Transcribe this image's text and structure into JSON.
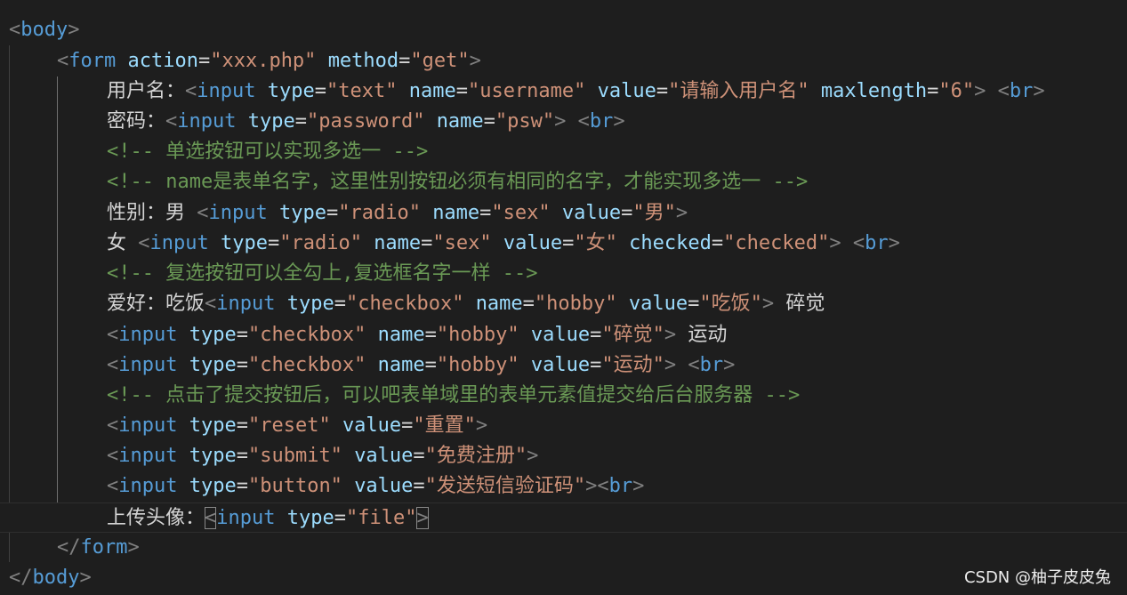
{
  "lines": [
    {
      "tokens": [
        [
          "tagp",
          "<"
        ],
        [
          "tag",
          "body"
        ],
        [
          "tagp",
          ">"
        ]
      ]
    },
    {
      "tokens": [
        [
          "tagp",
          "<"
        ],
        [
          "tag",
          "form"
        ],
        [
          "text",
          " "
        ],
        [
          "attr",
          "action"
        ],
        [
          "eq",
          "="
        ],
        [
          "str",
          "\"xxx.php\""
        ],
        [
          "text",
          " "
        ],
        [
          "attr",
          "method"
        ],
        [
          "eq",
          "="
        ],
        [
          "str",
          "\"get\""
        ],
        [
          "tagp",
          ">"
        ]
      ]
    },
    {
      "tokens": [
        [
          "text",
          "用户名："
        ],
        [
          "tagp",
          "<"
        ],
        [
          "tag",
          "input"
        ],
        [
          "text",
          " "
        ],
        [
          "attr",
          "type"
        ],
        [
          "eq",
          "="
        ],
        [
          "str",
          "\"text\""
        ],
        [
          "text",
          " "
        ],
        [
          "attr",
          "name"
        ],
        [
          "eq",
          "="
        ],
        [
          "str",
          "\"username\""
        ],
        [
          "text",
          " "
        ],
        [
          "attr",
          "value"
        ],
        [
          "eq",
          "="
        ],
        [
          "str",
          "\"请输入用户名\""
        ],
        [
          "text",
          " "
        ],
        [
          "attr",
          "maxlength"
        ],
        [
          "eq",
          "="
        ],
        [
          "str",
          "\"6\""
        ],
        [
          "tagp",
          ">"
        ],
        [
          "text",
          " "
        ],
        [
          "tagp",
          "<"
        ],
        [
          "tag",
          "br"
        ],
        [
          "tagp",
          ">"
        ]
      ]
    },
    {
      "tokens": [
        [
          "text",
          "密码："
        ],
        [
          "tagp",
          "<"
        ],
        [
          "tag",
          "input"
        ],
        [
          "text",
          " "
        ],
        [
          "attr",
          "type"
        ],
        [
          "eq",
          "="
        ],
        [
          "str",
          "\"password\""
        ],
        [
          "text",
          " "
        ],
        [
          "attr",
          "name"
        ],
        [
          "eq",
          "="
        ],
        [
          "str",
          "\"psw\""
        ],
        [
          "tagp",
          ">"
        ],
        [
          "text",
          " "
        ],
        [
          "tagp",
          "<"
        ],
        [
          "tag",
          "br"
        ],
        [
          "tagp",
          ">"
        ]
      ]
    },
    {
      "tokens": [
        [
          "com",
          "<!-- 单选按钮可以实现多选一 -->"
        ]
      ]
    },
    {
      "tokens": [
        [
          "com",
          "<!-- name是表单名字，这里性别按钮必须有相同的名字，才能实现多选一 -->"
        ]
      ]
    },
    {
      "tokens": [
        [
          "text",
          "性别：男 "
        ],
        [
          "tagp",
          "<"
        ],
        [
          "tag",
          "input"
        ],
        [
          "text",
          " "
        ],
        [
          "attr",
          "type"
        ],
        [
          "eq",
          "="
        ],
        [
          "str",
          "\"radio\""
        ],
        [
          "text",
          " "
        ],
        [
          "attr",
          "name"
        ],
        [
          "eq",
          "="
        ],
        [
          "str",
          "\"sex\""
        ],
        [
          "text",
          " "
        ],
        [
          "attr",
          "value"
        ],
        [
          "eq",
          "="
        ],
        [
          "str",
          "\"男\""
        ],
        [
          "tagp",
          ">"
        ]
      ]
    },
    {
      "tokens": [
        [
          "text",
          "女 "
        ],
        [
          "tagp",
          "<"
        ],
        [
          "tag",
          "input"
        ],
        [
          "text",
          " "
        ],
        [
          "attr",
          "type"
        ],
        [
          "eq",
          "="
        ],
        [
          "str",
          "\"radio\""
        ],
        [
          "text",
          " "
        ],
        [
          "attr",
          "name"
        ],
        [
          "eq",
          "="
        ],
        [
          "str",
          "\"sex\""
        ],
        [
          "text",
          " "
        ],
        [
          "attr",
          "value"
        ],
        [
          "eq",
          "="
        ],
        [
          "str",
          "\"女\""
        ],
        [
          "text",
          " "
        ],
        [
          "attr",
          "checked"
        ],
        [
          "eq",
          "="
        ],
        [
          "str",
          "\"checked\""
        ],
        [
          "tagp",
          ">"
        ],
        [
          "text",
          " "
        ],
        [
          "tagp",
          "<"
        ],
        [
          "tag",
          "br"
        ],
        [
          "tagp",
          ">"
        ]
      ]
    },
    {
      "tokens": [
        [
          "com",
          "<!-- 复选按钮可以全勾上,复选框名字一样 -->"
        ]
      ]
    },
    {
      "tokens": [
        [
          "text",
          "爱好：吃饭"
        ],
        [
          "tagp",
          "<"
        ],
        [
          "tag",
          "input"
        ],
        [
          "text",
          " "
        ],
        [
          "attr",
          "type"
        ],
        [
          "eq",
          "="
        ],
        [
          "str",
          "\"checkbox\""
        ],
        [
          "text",
          " "
        ],
        [
          "attr",
          "name"
        ],
        [
          "eq",
          "="
        ],
        [
          "str",
          "\"hobby\""
        ],
        [
          "text",
          " "
        ],
        [
          "attr",
          "value"
        ],
        [
          "eq",
          "="
        ],
        [
          "str",
          "\"吃饭\""
        ],
        [
          "tagp",
          ">"
        ],
        [
          "text",
          " 碎觉"
        ]
      ]
    },
    {
      "tokens": [
        [
          "tagp",
          "<"
        ],
        [
          "tag",
          "input"
        ],
        [
          "text",
          " "
        ],
        [
          "attr",
          "type"
        ],
        [
          "eq",
          "="
        ],
        [
          "str",
          "\"checkbox\""
        ],
        [
          "text",
          " "
        ],
        [
          "attr",
          "name"
        ],
        [
          "eq",
          "="
        ],
        [
          "str",
          "\"hobby\""
        ],
        [
          "text",
          " "
        ],
        [
          "attr",
          "value"
        ],
        [
          "eq",
          "="
        ],
        [
          "str",
          "\"碎觉\""
        ],
        [
          "tagp",
          ">"
        ],
        [
          "text",
          " 运动"
        ]
      ]
    },
    {
      "tokens": [
        [
          "tagp",
          "<"
        ],
        [
          "tag",
          "input"
        ],
        [
          "text",
          " "
        ],
        [
          "attr",
          "type"
        ],
        [
          "eq",
          "="
        ],
        [
          "str",
          "\"checkbox\""
        ],
        [
          "text",
          " "
        ],
        [
          "attr",
          "name"
        ],
        [
          "eq",
          "="
        ],
        [
          "str",
          "\"hobby\""
        ],
        [
          "text",
          " "
        ],
        [
          "attr",
          "value"
        ],
        [
          "eq",
          "="
        ],
        [
          "str",
          "\"运动\""
        ],
        [
          "tagp",
          ">"
        ],
        [
          "text",
          " "
        ],
        [
          "tagp",
          "<"
        ],
        [
          "tag",
          "br"
        ],
        [
          "tagp",
          ">"
        ]
      ]
    },
    {
      "tokens": [
        [
          "com",
          "<!-- 点击了提交按钮后，可以吧表单域里的表单元素值提交给后台服务器 -->"
        ]
      ]
    },
    {
      "tokens": [
        [
          "tagp",
          "<"
        ],
        [
          "tag",
          "input"
        ],
        [
          "text",
          " "
        ],
        [
          "attr",
          "type"
        ],
        [
          "eq",
          "="
        ],
        [
          "str",
          "\"reset\""
        ],
        [
          "text",
          " "
        ],
        [
          "attr",
          "value"
        ],
        [
          "eq",
          "="
        ],
        [
          "str",
          "\"重置\""
        ],
        [
          "tagp",
          ">"
        ]
      ]
    },
    {
      "tokens": [
        [
          "tagp",
          "<"
        ],
        [
          "tag",
          "input"
        ],
        [
          "text",
          " "
        ],
        [
          "attr",
          "type"
        ],
        [
          "eq",
          "="
        ],
        [
          "str",
          "\"submit\""
        ],
        [
          "text",
          " "
        ],
        [
          "attr",
          "value"
        ],
        [
          "eq",
          "="
        ],
        [
          "str",
          "\"免费注册\""
        ],
        [
          "tagp",
          ">"
        ]
      ]
    },
    {
      "tokens": [
        [
          "tagp",
          "<"
        ],
        [
          "tag",
          "input"
        ],
        [
          "text",
          " "
        ],
        [
          "attr",
          "type"
        ],
        [
          "eq",
          "="
        ],
        [
          "str",
          "\"button\""
        ],
        [
          "text",
          " "
        ],
        [
          "attr",
          "value"
        ],
        [
          "eq",
          "="
        ],
        [
          "str",
          "\"发送短信验证码\""
        ],
        [
          "tagp",
          ">"
        ],
        [
          "tagp",
          "<"
        ],
        [
          "tag",
          "br"
        ],
        [
          "tagp",
          ">"
        ]
      ]
    },
    {
      "tokens": [
        [
          "text",
          "上传头像："
        ],
        [
          "tagp",
          "<"
        ],
        [
          "tag",
          "input"
        ],
        [
          "text",
          " "
        ],
        [
          "attr",
          "type"
        ],
        [
          "eq",
          "="
        ],
        [
          "str",
          "\"file\""
        ],
        [
          "tagp",
          ">"
        ]
      ]
    },
    {
      "tokens": [
        [
          "tagp",
          "</"
        ],
        [
          "tag",
          "form"
        ],
        [
          "tagp",
          ">"
        ]
      ]
    },
    {
      "tokens": [
        [
          "tagp",
          "</"
        ],
        [
          "tag",
          "body"
        ],
        [
          "tagp",
          ">"
        ]
      ]
    }
  ],
  "watermark": "CSDN @柚子皮皮兔",
  "colors": {
    "background": "#1e1e1e",
    "tag": "#569cd6",
    "attribute": "#9cdcfe",
    "string": "#ce9178",
    "comment": "#6a9955",
    "text": "#d4d4d4",
    "punctuation": "#808080"
  }
}
